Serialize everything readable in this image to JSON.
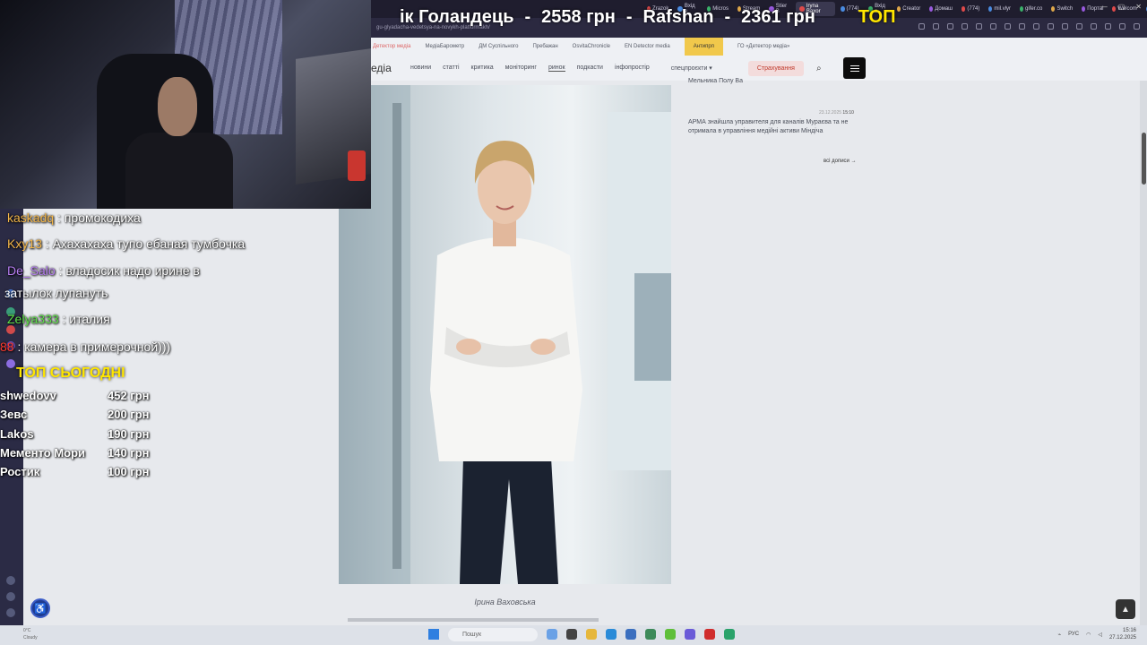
{
  "browser": {
    "tabs": [
      "Zrazok",
      "Вхід в",
      "Micros",
      "Stream",
      "Stier B",
      "Iryna Baxor",
      "(774)",
      "Вхід в",
      "Creator",
      "Домаш",
      "(774)",
      "mil.vlyr",
      "gifer.co",
      "Switch",
      "Портаl",
      "Welcom",
      "Войти",
      "Iryna V"
    ],
    "active_tab_index": 5,
    "url": "gu-glyadacha-vedetsya-na-novykh-platformakh/"
  },
  "ticker": {
    "entry1_name": "ік Голандець",
    "entry1_amount": "2558 грн",
    "entry2_name": "Rafshan",
    "entry2_amount": "2361 грн",
    "dash": "-",
    "label_top": "ТОП"
  },
  "site": {
    "band_items": [
      "Детектор медіа",
      "МедіаБарометр",
      "ДМ Суспільного",
      "Пребажан",
      "OsvitaChronicle",
      "EN Detector media",
      "Антипрп",
      "ГО «Детектор медіа»"
    ],
    "logo": "едіа",
    "nav": [
      "новини",
      "статті",
      "критика",
      "моніторинг",
      "ринок",
      "подкасти",
      "інфопростір"
    ],
    "nav_current": "ринок",
    "special": "спецпроєкти ▾",
    "insurance": "Страхування"
  },
  "sidebar_posts": [
    {
      "date": "",
      "time": "",
      "text": "Мельника Полу Ва"
    },
    {
      "date": "23.12.2025",
      "time": "15:10",
      "text": "АРМА знайшла управителя для каналів Мураєва та не отримала в управління медійні активи Міндіча"
    }
  ],
  "all_posts_label": "всі дописи →",
  "article": {
    "caption": "Ірина Ваховська"
  },
  "chat": [
    {
      "user": "kaskadq",
      "color": "#f3b64a",
      "text": ": промокодиха"
    },
    {
      "user": "Kxy13",
      "color": "#f3b64a",
      "text": ": Ахахахаха тупо ебаная тумбочка"
    },
    {
      "user": "De_Salo",
      "color": "#b57cf0",
      "text": ": владосик надо ирине в"
    },
    {
      "user": "",
      "color": "#ffffff",
      "text": "затылок лупануть"
    },
    {
      "user": "Zelya333",
      "color": "#5fe04a",
      "text": ": италия"
    },
    {
      "user": "88",
      "color": "#ff3b30",
      "text": ": камера в примерочной)))"
    }
  ],
  "top_today": {
    "title": "ТОП СЬОГОДНІ",
    "rows": [
      {
        "name": "shwedovv",
        "amount": "452 грн"
      },
      {
        "name": "Зевс",
        "amount": "200 грн"
      },
      {
        "name": "Lakos",
        "amount": "190 грн"
      },
      {
        "name": "Мементо Мори",
        "amount": "140 грн"
      },
      {
        "name": "Ростик",
        "amount": "100 грн"
      }
    ]
  },
  "taskbar": {
    "weather_temp": "0°C",
    "weather_text": "Cloudy",
    "search_placeholder": "Пошук",
    "lang": "РУС",
    "time": "15:16",
    "date": "27.12.2025"
  },
  "colors": {
    "ticker_top": "#ffe600",
    "insurance_text": "#c0392b",
    "highlight_band": "#f1c84b"
  }
}
